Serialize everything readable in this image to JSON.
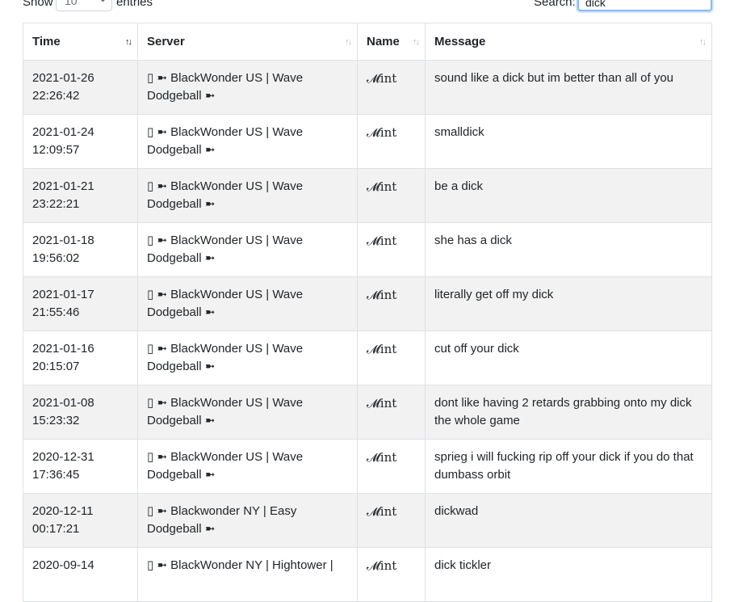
{
  "controls": {
    "show_label": "Show",
    "page_size": "10",
    "entries_label": "entries",
    "search_label": "Search:",
    "search_value": "dick"
  },
  "table": {
    "headers": [
      "Time",
      "Server",
      "Name",
      "Message"
    ],
    "sort_icon": "⇅",
    "rows": [
      {
        "time": "2021-01-26 22:26:42",
        "server": "▯ ➼ BlackWonder US | Wave Dodgeball ➼",
        "name": "𝓜int",
        "message": "sound like a dick but im better than all of you"
      },
      {
        "time": "2021-01-24 12:09:57",
        "server": "▯ ➼ BlackWonder US | Wave Dodgeball ➼",
        "name": "𝓜int",
        "message": "smalldick"
      },
      {
        "time": "2021-01-21 23:22:21",
        "server": "▯ ➼ BlackWonder US | Wave Dodgeball ➼",
        "name": "𝓜int",
        "message": "be a dick"
      },
      {
        "time": "2021-01-18 19:56:02",
        "server": "▯ ➼ BlackWonder US | Wave Dodgeball ➼",
        "name": "𝓜int",
        "message": "she has a dick"
      },
      {
        "time": "2021-01-17 21:55:46",
        "server": "▯ ➼ BlackWonder US | Wave Dodgeball ➼",
        "name": "𝓜int",
        "message": "literally get off my dick"
      },
      {
        "time": "2021-01-16 20:15:07",
        "server": "▯ ➼ BlackWonder US | Wave Dodgeball ➼",
        "name": "𝓜int",
        "message": "cut off your dick"
      },
      {
        "time": "2021-01-08 15:23:32",
        "server": "▯ ➼ BlackWonder US | Wave Dodgeball ➼",
        "name": "𝓜int",
        "message": "dont like having 2 retards grabbing onto my dick the whole game"
      },
      {
        "time": "2020-12-31 17:36:45",
        "server": "▯ ➼ BlackWonder US | Wave Dodgeball ➼",
        "name": "𝓜int",
        "message": "sprieg i will fucking rip off your dick if you do that dumbass orbit"
      },
      {
        "time": "2020-12-11 00:17:21",
        "server": "▯ ➼ Blackwonder NY | Easy Dodgeball ➼",
        "name": "𝓜int",
        "message": "dickwad"
      },
      {
        "time": "2020-09-14",
        "server": "▯ ➼ BlackWonder NY | Hightower |",
        "name": "𝓜int",
        "message": "dick tickler"
      }
    ]
  }
}
